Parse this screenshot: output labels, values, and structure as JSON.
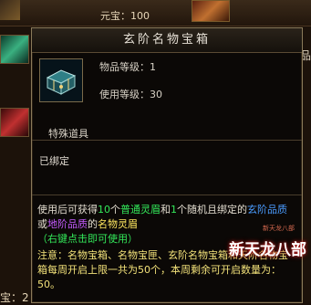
{
  "background": {
    "yuanbao_label": "元宝：100",
    "right_edge_text": "品",
    "bottom_left_text": "宝：2"
  },
  "tooltip": {
    "title": "玄阶名物宝箱",
    "item_level": "物品等级：1",
    "use_level": "使用等级：30",
    "category": "特殊道具",
    "bind_status": "已绑定",
    "description": {
      "p1": "使用后可获得",
      "count1": "10",
      "p2": "个",
      "common_fragment": "普通灵眉",
      "p3": "和",
      "count2": "1",
      "p4": "个随机且绑定的",
      "xuan_quality": "玄阶品质",
      "p5": "或",
      "di_quality": "地阶品质",
      "p6": "的",
      "famous_item": "名物灵眉",
      "hint": "（右键点击即可使用）",
      "note": "注意：名物宝箱、名物宝匣、玄阶名物宝箱和天阶名物宝箱每周开启上限一共为50个，本周剩余可开启数量为：50。"
    },
    "watermark": {
      "small": "新天龙八部",
      "big": "新天龙八部"
    }
  },
  "colors": {
    "green": "#33e85a",
    "blue": "#4a9cff",
    "purple": "#c55cff",
    "yellow": "#ffe860",
    "note": "#f3e27a"
  }
}
